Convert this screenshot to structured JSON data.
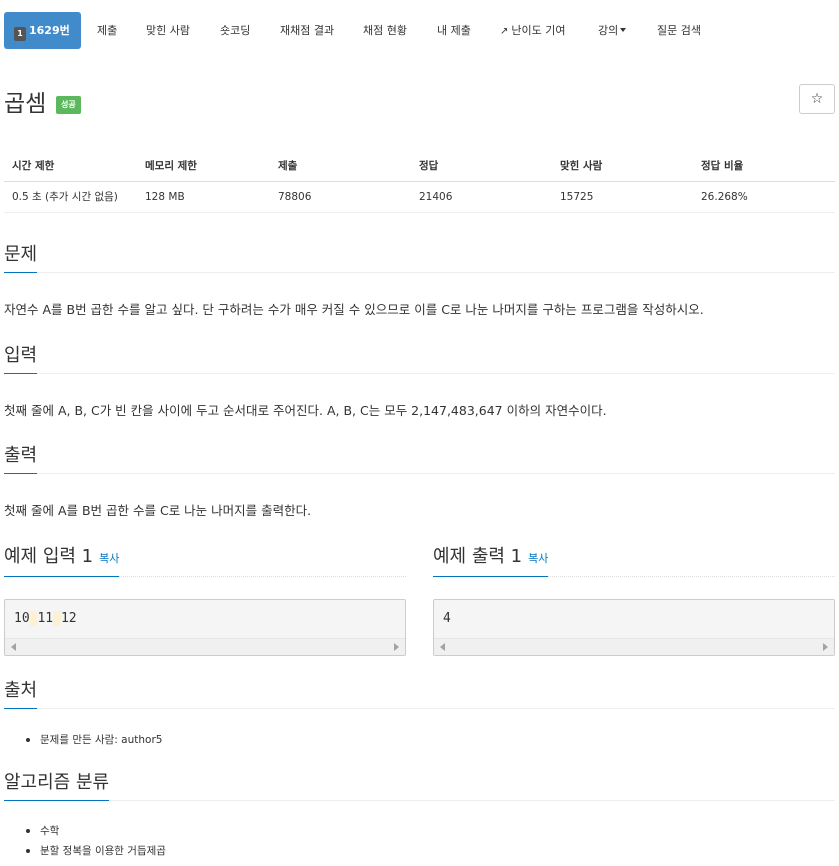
{
  "nav": {
    "tier_badge": "1",
    "problem_tab": "1629번",
    "tabs": [
      "제출",
      "맞힌 사람",
      "숏코딩",
      "재채점 결과",
      "채점 현황",
      "내 제출",
      "난이도 기여",
      "강의",
      "질문 검색"
    ]
  },
  "problem": {
    "title": "곱셈",
    "status": "성공",
    "star": "☆"
  },
  "info": {
    "headers": [
      "시간 제한",
      "메모리 제한",
      "제출",
      "정답",
      "맞힌 사람",
      "정답 비율"
    ],
    "values": [
      "0.5 초 (추가 시간 없음)",
      "128 MB",
      "78806",
      "21406",
      "15725",
      "26.268%"
    ]
  },
  "sections": {
    "problem": {
      "title": "문제",
      "text": "자연수 A를 B번 곱한 수를 알고 싶다. 단 구하려는 수가 매우 커질 수 있으므로 이를 C로 나눈 나머지를 구하는 프로그램을 작성하시오."
    },
    "input": {
      "title": "입력",
      "text": "첫째 줄에 A, B, C가 빈 칸을 사이에 두고 순서대로 주어진다. A, B, C는 모두 2,147,483,647 이하의 자연수이다."
    },
    "output": {
      "title": "출력",
      "text": "첫째 줄에 A를 B번 곱한 수를 C로 나눈 나머지를 출력한다."
    }
  },
  "samples": {
    "copy_label": "복사",
    "input": {
      "title": "예제 입력 1",
      "tokens": [
        "10",
        "11",
        "12"
      ]
    },
    "output": {
      "title": "예제 출력 1",
      "value": "4"
    }
  },
  "source": {
    "title": "출처",
    "items": [
      "문제를 만든 사람: author5"
    ]
  },
  "algorithm": {
    "title": "알고리즘 분류",
    "items": [
      "수학",
      "분할 정복을 이용한 거듭제곱"
    ]
  },
  "colors": {
    "primary": "#428bca",
    "success": "#5cb85c",
    "link": "#0076c0",
    "highlight": "#fcf1d3"
  }
}
